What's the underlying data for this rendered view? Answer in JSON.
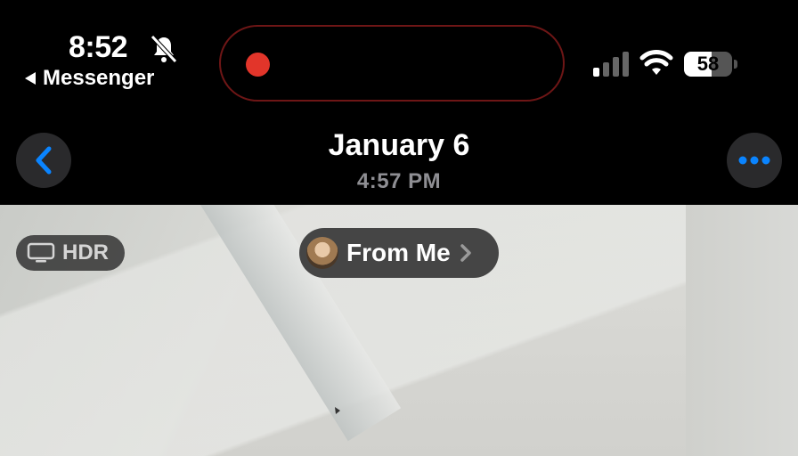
{
  "status_bar": {
    "time": "8:52",
    "back_app_label": "Messenger",
    "battery_percent": "58",
    "battery_level": 0.58,
    "recording_color": "#e2352a",
    "icons": [
      "bell-slash-icon",
      "signal-icon",
      "wifi-icon",
      "battery-icon"
    ]
  },
  "nav": {
    "title": "January 6",
    "subtitle": "4:57 PM",
    "back_icon": "chevron-left-icon",
    "more_icon": "ellipsis-icon",
    "accent_color": "#0a84ff"
  },
  "photo": {
    "hdr_label": "HDR",
    "hdr_icon": "display-icon",
    "from_label": "From Me",
    "from_icon": "chevron-right-icon"
  }
}
